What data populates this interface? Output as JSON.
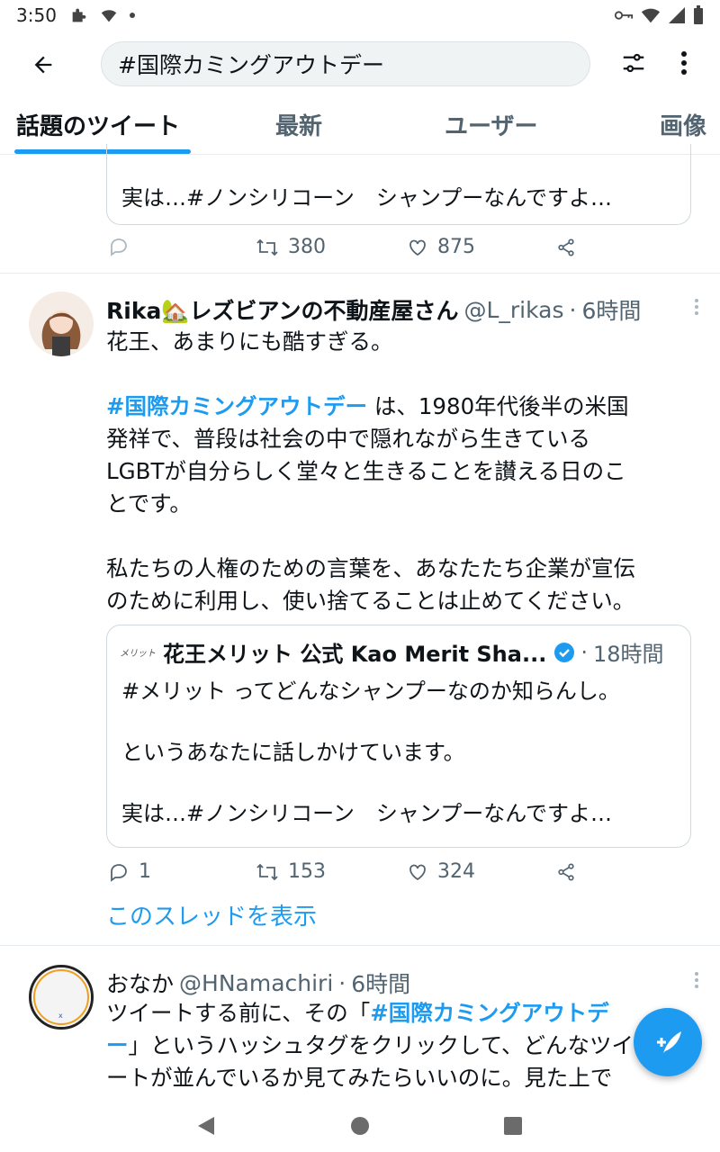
{
  "status_bar": {
    "time": "3:50"
  },
  "search": {
    "query": "#国際カミングアウトデー"
  },
  "tabs": [
    {
      "label": "話題のツイート",
      "active": true
    },
    {
      "label": "最新",
      "active": false
    },
    {
      "label": "ユーザー",
      "active": false
    },
    {
      "label": "画像",
      "active": false
    }
  ],
  "prev_tweet": {
    "quote_last_line": "実は…#ノンシリコーン　シャンプーなんですよ…",
    "retweets": "380",
    "likes": "875"
  },
  "tweet1": {
    "name": "Rika🏡レズビアンの不動産屋さん",
    "handle": "@L_rikas",
    "separator": "·",
    "time": "6時間",
    "line1": "花王、あまりにも酷すぎる。",
    "hashtag": "#国際カミングアウトデー",
    "line2_rest": " は、1980年代後半の米国",
    "line3": "発祥で、普段は社会の中で隠れながら生きている",
    "line4": "LGBTが自分らしく堂々と生きることを讃える日のこ",
    "line5": "とです。",
    "line6": "私たちの人権のための言葉を、あなたたち企業が宣伝",
    "line7": "のために利用し、使い捨てることは止めてください。",
    "quote": {
      "logo": "メリット",
      "name": "花王メリット 公式 Kao Merit Sha...",
      "separator": "·",
      "time": "18時間",
      "line1": "#メリット ってどんなシャンプーなのか知らんし。",
      "line2": "というあなたに話しかけています。",
      "line3": "実は…#ノンシリコーン　シャンプーなんですよ…"
    },
    "replies": "1",
    "retweets": "153",
    "likes": "324",
    "show_thread": "このスレッドを表示"
  },
  "tweet2": {
    "name": "おなか",
    "handle": "@HNamachiri",
    "separator": "·",
    "time": "6時間",
    "line1_pre": "ツイートする前に、その「",
    "hashtag_a": "#国際カミングアウトデ",
    "hashtag_b": "ー",
    "line2_rest": "」というハッシュタグをクリックして、どんなツイ",
    "line3": "ートが並んでいるか見てみたらいいのに。見た上で"
  },
  "colors": {
    "accent": "#1d9bf0",
    "text": "#0f1419",
    "muted": "#536471",
    "border": "#cfd9de"
  }
}
